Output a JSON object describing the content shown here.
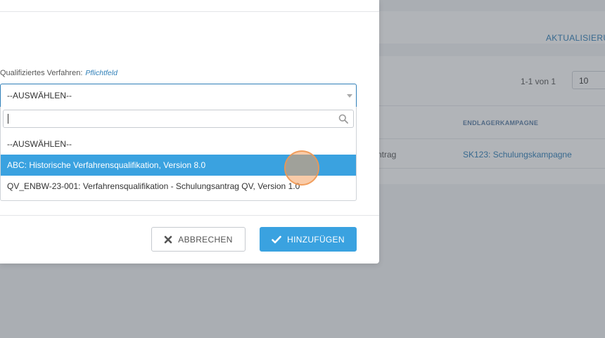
{
  "background": {
    "refresh_label": "AKTUALISIERUN",
    "pagination_text": "1-1 von 1",
    "page_size": "10",
    "table_header": "ENDLAGERKAMPAGNE",
    "row_cell_left": "ntrag",
    "row_cell_campaign": "SK123: Schulungskampagne"
  },
  "modal": {
    "field_label": "Qualifiziertes Verfahren:",
    "required_label": "Pflichtfeld",
    "select_value": "--AUSWÄHLEN--",
    "search_value": "",
    "options": [
      "--AUSWÄHLEN--",
      "ABC: Historische Verfahrensqualifikation, Version 8.0",
      "QV_ENBW-23-001: Verfahrensqualifikation - Schulungsantrag QV, Version 1.0"
    ],
    "highlighted_option_index": 1,
    "cancel_label": "ABBRECHEN",
    "add_label": "HINZUFÜGEN"
  },
  "colors": {
    "accent": "#3aa2e0",
    "link": "#2f7fb8",
    "click_indicator": "#f4a160"
  },
  "icons": {
    "select_caret": "chevron-down-icon",
    "search": "search-icon",
    "cancel": "close-icon",
    "add": "check-icon"
  }
}
